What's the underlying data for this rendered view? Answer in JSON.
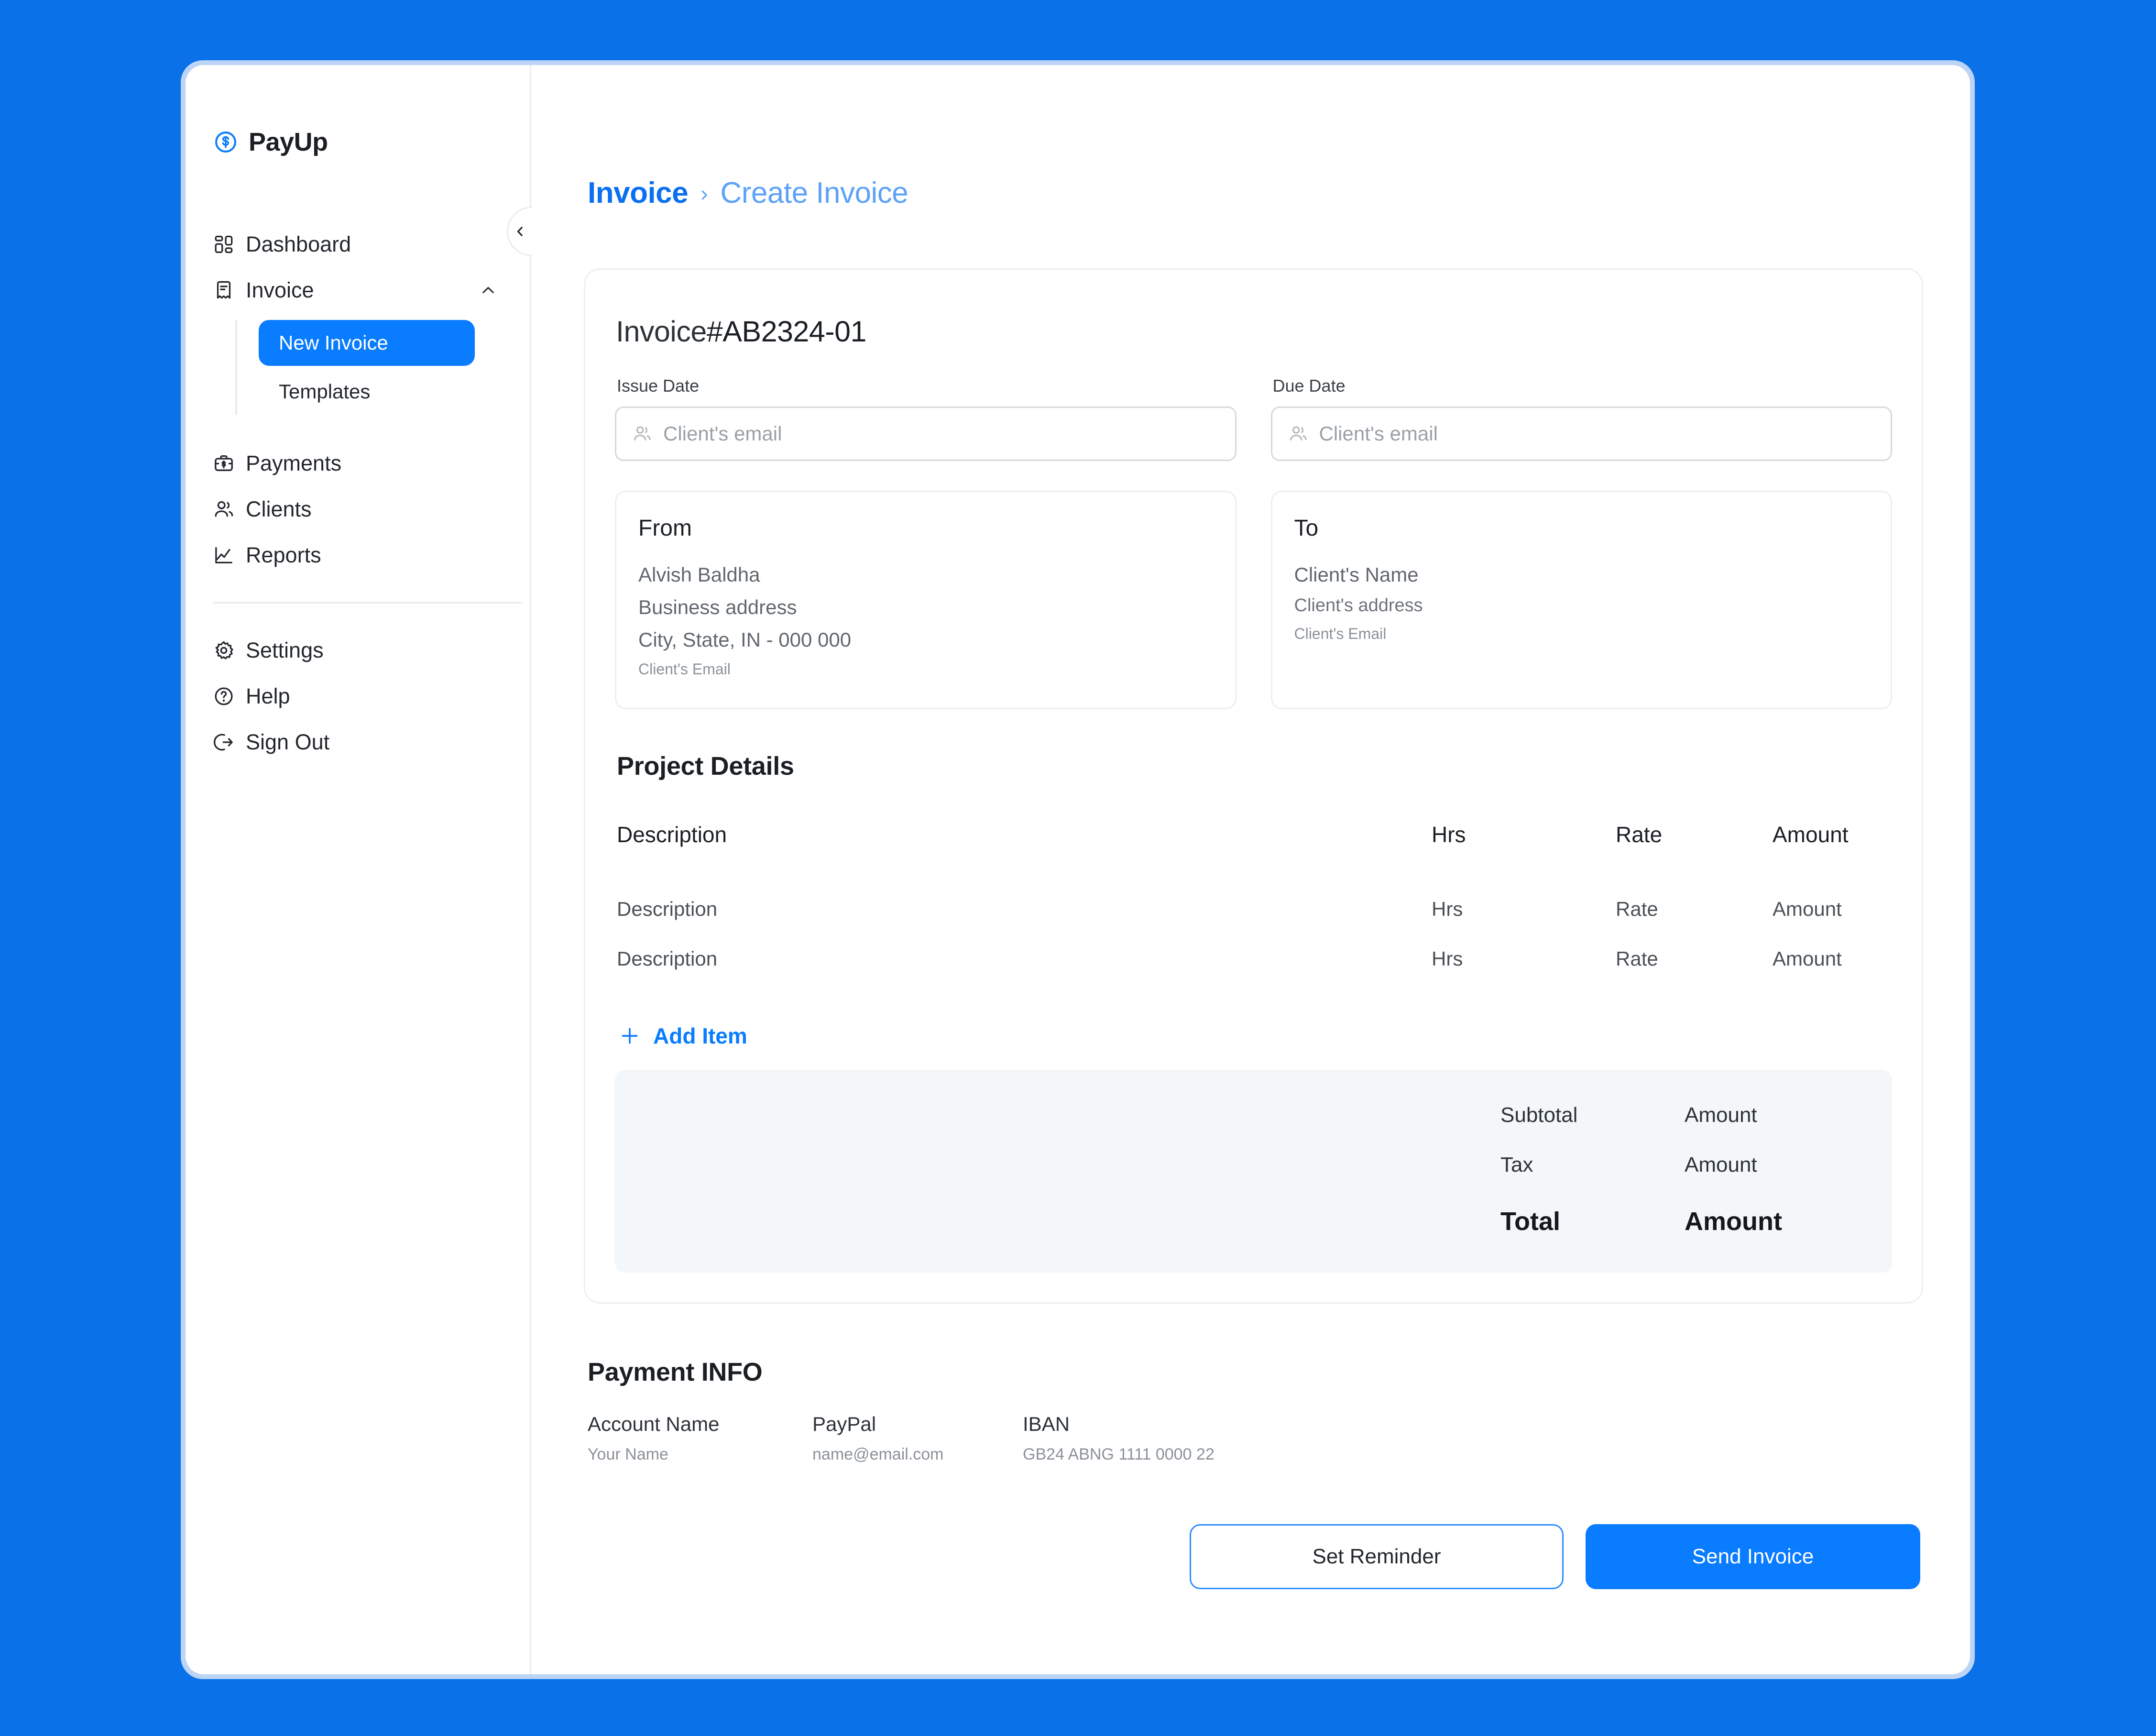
{
  "theme": {
    "page_background": "#0A71E8",
    "window_frame": "#BCD4F5",
    "accent_blue": "#0A7CFF",
    "breadcrumb_active": "#0A6FF0",
    "breadcrumb_current": "#5CA2F8",
    "totals_panel_bg": "#F4F7FA",
    "border_gray": "#EDEFF2"
  },
  "sidebar": {
    "brand": {
      "name": "PayUp",
      "icon": "dollar-circle-icon"
    },
    "items": [
      {
        "label": "Dashboard",
        "icon": "dashboard-grid-icon"
      },
      {
        "label": "Invoice",
        "icon": "receipt-icon",
        "expanded": true,
        "chevron": "chevron-up-icon"
      },
      {
        "label": "Payments",
        "icon": "briefcase-dollar-icon"
      },
      {
        "label": "Clients",
        "icon": "users-icon"
      },
      {
        "label": "Reports",
        "icon": "chart-line-icon"
      }
    ],
    "sub_items": [
      {
        "label": "New Invoice",
        "active": true
      },
      {
        "label": "Templates",
        "active": false
      }
    ],
    "footer_items": [
      {
        "label": "Settings",
        "icon": "gear-icon"
      },
      {
        "label": "Help",
        "icon": "question-circle-icon"
      },
      {
        "label": "Sign Out",
        "icon": "logout-icon"
      }
    ],
    "collapse_toggle_icon": "chevron-left-icon"
  },
  "breadcrumb": {
    "parent": "Invoice",
    "separator": "›",
    "current": "Create Invoice"
  },
  "invoice": {
    "number_prefix": "Invoice",
    "number": "#AB2324-01",
    "issue_date": {
      "label": "Issue Date",
      "value": "",
      "placeholder": "Client's email",
      "icon": "users-icon"
    },
    "due_date": {
      "label": "Due Date",
      "value": "",
      "placeholder": "Client's email",
      "icon": "users-icon"
    },
    "from": {
      "title": "From",
      "name": "Alvish Baldha",
      "address": "Business address",
      "city_line": "City, State, IN - 000 000",
      "email": "Client's Email"
    },
    "to": {
      "title": "To",
      "name": "Client's Name",
      "address": "Client's address",
      "email": "Client's Email"
    },
    "project_details": {
      "title": "Project Details",
      "columns": [
        "Description",
        "Hrs",
        "Rate",
        "Amount"
      ],
      "rows": [
        {
          "description": "Description",
          "hrs": "Hrs",
          "rate": "Rate",
          "amount": "Amount"
        },
        {
          "description": "Description",
          "hrs": "Hrs",
          "rate": "Rate",
          "amount": "Amount"
        }
      ],
      "add_item_label": "Add Item",
      "add_item_icon": "plus-icon"
    },
    "totals": {
      "subtotal_label": "Subtotal",
      "subtotal_value": "Amount",
      "tax_label": "Tax",
      "tax_value": "Amount",
      "total_label": "Total",
      "total_value": "Amount"
    }
  },
  "payment_info": {
    "title": "Payment INFO",
    "fields": [
      {
        "label": "Account Name",
        "value": "Your Name"
      },
      {
        "label": "PayPal",
        "value": "name@email.com"
      },
      {
        "label": "IBAN",
        "value": "GB24 ABNG 1111 0000 22"
      }
    ]
  },
  "actions": {
    "set_reminder": "Set Reminder",
    "send_invoice": "Send Invoice"
  }
}
